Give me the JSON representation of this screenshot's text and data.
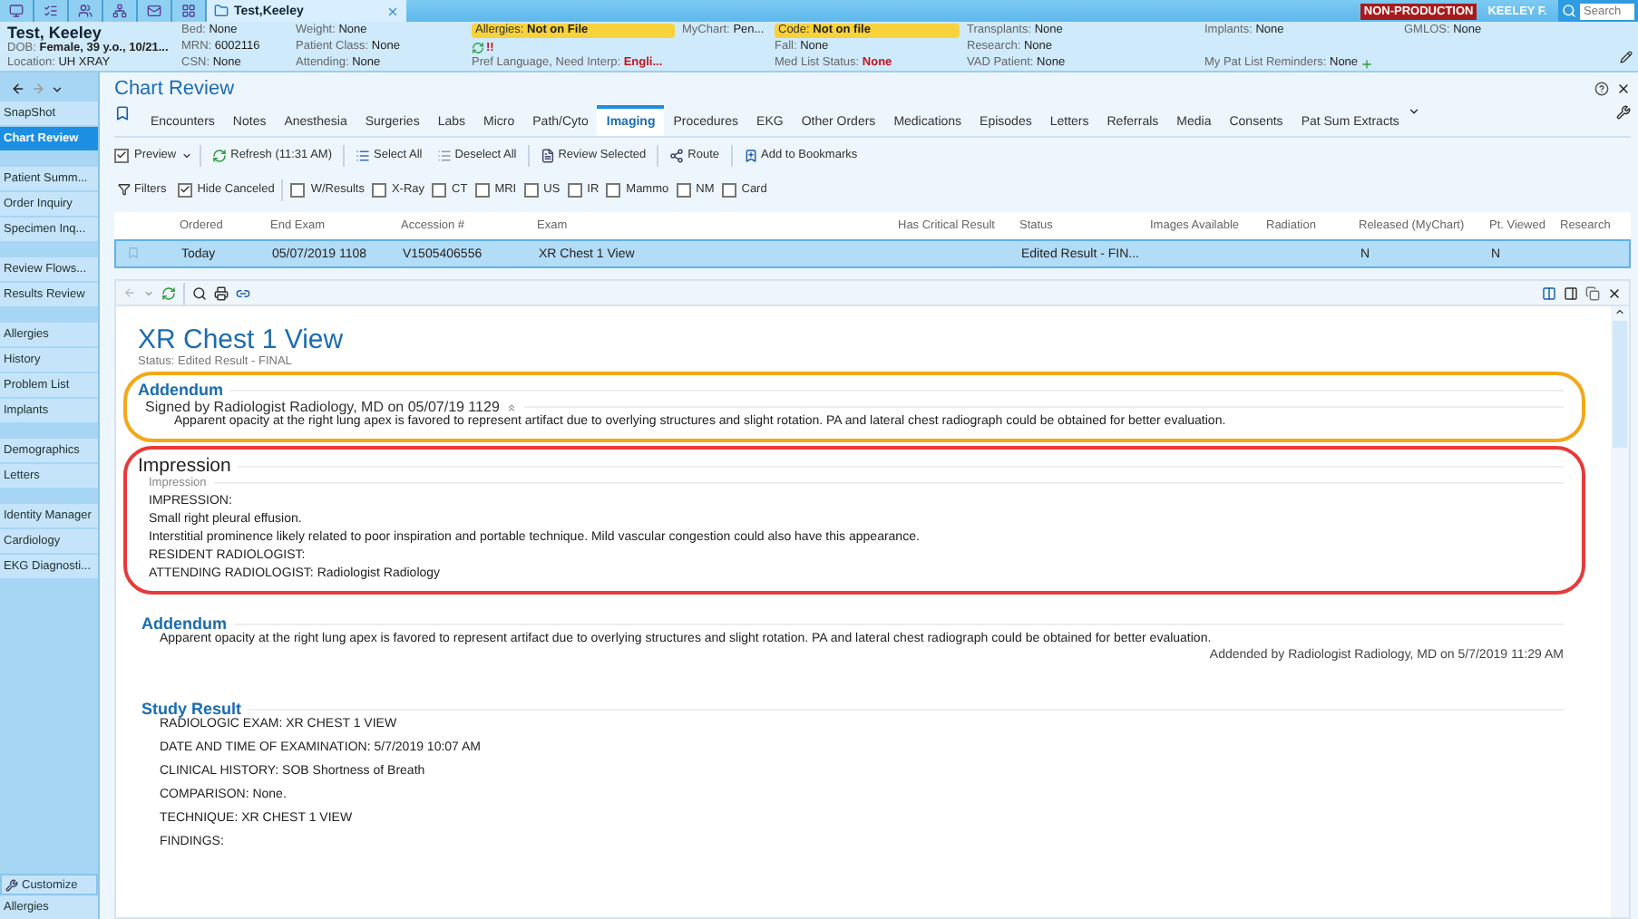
{
  "top_bar": {
    "tab_title": "Test,Keeley",
    "environment_badge": "NON-PRODUCTION",
    "user": "KEELEY F.",
    "search": {
      "placeholder": "Search"
    }
  },
  "patient_header": {
    "columns": [
      [
        {
          "kind": "name",
          "value": "Test, Keeley"
        },
        {
          "kind": "field",
          "label": "DOB:",
          "value": "Female, 39 y.o., 10/21...",
          "bold": true
        },
        {
          "kind": "field",
          "label": "Location:",
          "value": "UH XRAY"
        }
      ],
      [
        {
          "kind": "field",
          "label": "Bed:",
          "value": "None"
        },
        {
          "kind": "field",
          "label": "MRN:",
          "value": "6002116"
        },
        {
          "kind": "field",
          "label": "CSN:",
          "value": "None"
        }
      ],
      [
        {
          "kind": "field",
          "label": "Weight:",
          "value": "None"
        },
        {
          "kind": "field",
          "label": "Patient Class:",
          "value": "None"
        },
        {
          "kind": "field",
          "label": "Attending:",
          "value": "None"
        }
      ],
      [
        {
          "kind": "flag",
          "label": "Allergies:",
          "value": "Not on File"
        },
        {
          "kind": "status",
          "value": "!!"
        },
        {
          "kind": "field",
          "label": "Pref Language, Need Interp:",
          "value": "Engli...",
          "alert": true
        }
      ],
      [
        {
          "kind": "field",
          "label": "MyChart:",
          "value": "Pen..."
        }
      ],
      [
        {
          "kind": "flag",
          "label": "Code:",
          "value": "Not on file"
        },
        {
          "kind": "field",
          "label": "Fall:",
          "value": "None"
        },
        {
          "kind": "field",
          "label": "Med List Status:",
          "value": "None",
          "alert": true
        }
      ],
      [
        {
          "kind": "field",
          "label": "Transplants:",
          "value": "None"
        },
        {
          "kind": "field",
          "label": "Research:",
          "value": "None"
        },
        {
          "kind": "field",
          "label": "VAD Patient:",
          "value": "None"
        }
      ],
      [
        {
          "kind": "field",
          "label": "Implants:",
          "value": "None"
        },
        {
          "kind": "add",
          "label": "My Pat List Reminders:",
          "value": "None"
        }
      ],
      [
        {
          "kind": "field",
          "label": "GMLOS:",
          "value": "None"
        }
      ]
    ]
  },
  "sidebar": {
    "groups": [
      [
        {
          "label": "SnapShot",
          "selected": false
        },
        {
          "label": "Chart Review",
          "selected": true
        }
      ],
      [
        {
          "label": "Patient Summ...",
          "selected": false
        },
        {
          "label": "Order Inquiry",
          "selected": false
        },
        {
          "label": "Specimen Inq...",
          "selected": false
        }
      ],
      [
        {
          "label": "Review Flows...",
          "selected": false
        },
        {
          "label": "Results Review",
          "selected": false
        }
      ],
      [
        {
          "label": "Allergies",
          "selected": false
        },
        {
          "label": "History",
          "selected": false
        },
        {
          "label": "Problem List",
          "selected": false
        },
        {
          "label": "Implants",
          "selected": false
        }
      ],
      [
        {
          "label": "Demographics",
          "selected": false
        },
        {
          "label": "Letters",
          "selected": false
        }
      ],
      [
        {
          "label": "Identity Manager",
          "selected": false
        },
        {
          "label": "Cardiology",
          "selected": false
        },
        {
          "label": "EKG Diagnosti...",
          "selected": false
        }
      ]
    ],
    "customize_button": "Customize",
    "bottom_item": "Allergies"
  },
  "activity": {
    "title": "Chart Review",
    "tabs": [
      {
        "label": "Encounters",
        "selected": false
      },
      {
        "label": "Notes",
        "selected": false
      },
      {
        "label": "Anesthesia",
        "selected": false
      },
      {
        "label": "Surgeries",
        "selected": false
      },
      {
        "label": "Labs",
        "selected": false
      },
      {
        "label": "Micro",
        "selected": false
      },
      {
        "label": "Path/Cyto",
        "selected": false
      },
      {
        "label": "Imaging",
        "selected": true
      },
      {
        "label": "Procedures",
        "selected": false
      },
      {
        "label": "EKG",
        "selected": false
      },
      {
        "label": "Other Orders",
        "selected": false
      },
      {
        "label": "Medications",
        "selected": false
      },
      {
        "label": "Episodes",
        "selected": false
      },
      {
        "label": "Letters",
        "selected": false
      },
      {
        "label": "Referrals",
        "selected": false
      },
      {
        "label": "Media",
        "selected": false
      },
      {
        "label": "Consents",
        "selected": false
      },
      {
        "label": "Pat Sum Extracts",
        "selected": false
      }
    ],
    "toolbar": [
      {
        "kind": "preview",
        "label": "Preview",
        "checked": true
      },
      {
        "kind": "refresh",
        "label": "Refresh (11:31 AM)"
      },
      {
        "kind": "select",
        "label": "Select All"
      },
      {
        "kind": "deselect",
        "label": "Deselect All"
      },
      {
        "kind": "review",
        "label": "Review Selected"
      },
      {
        "kind": "route",
        "label": "Route"
      },
      {
        "kind": "bookmark",
        "label": "Add to Bookmarks"
      }
    ],
    "filters": {
      "label": "Filters",
      "options": [
        {
          "label": "Hide Canceled",
          "checked": true
        },
        {
          "label": "W/Results",
          "checked": false
        },
        {
          "label": "X-Ray",
          "checked": false
        },
        {
          "label": "CT",
          "checked": false
        },
        {
          "label": "MRI",
          "checked": false
        },
        {
          "label": "US",
          "checked": false
        },
        {
          "label": "IR",
          "checked": false
        },
        {
          "label": "Mammo",
          "checked": false
        },
        {
          "label": "NM",
          "checked": false
        },
        {
          "label": "Card",
          "checked": false
        }
      ]
    },
    "table": {
      "columns": [
        "Ordered",
        "End Exam",
        "Accession #",
        "Exam",
        "Has Critical Result",
        "Status",
        "Images Available",
        "Radiation",
        "Released (MyChart)",
        "Pt. Viewed",
        "Research"
      ],
      "rows": [
        {
          "selected": true,
          "cells": [
            "Today",
            "05/07/2019 1108",
            "V1505406556",
            "XR Chest 1 View",
            null,
            "Edited Result - FIN...",
            null,
            null,
            "N",
            "N",
            null
          ]
        }
      ]
    }
  },
  "report": {
    "title": "XR Chest 1 View",
    "status": "Status: Edited Result - FINAL",
    "sections": [
      {
        "kind": "signed",
        "heading": "Addendum",
        "color": "#f2a818",
        "signed_by": "Signed by Radiologist Radiology, MD on 05/07/19 1129",
        "lines": [
          "Apparent opacity at the right lung apex is favored to represent artifact due to overlying structures and slight rotation. PA and lateral chest radiograph could be obtained for better evaluation."
        ]
      },
      {
        "kind": "impression",
        "heading": "Impression",
        "color": "#e83a3a",
        "subheading": "Impression",
        "lines": [
          "IMPRESSION:",
          "Small right pleural effusion.",
          "Interstitial prominence likely related to poor inspiration and portable technique. Mild vascular congestion could also have this appearance.",
          "RESIDENT RADIOLOGIST:",
          "ATTENDING RADIOLOGIST: Radiologist Radiology"
        ]
      },
      {
        "kind": "addendum",
        "heading": "Addendum",
        "lines": [
          "Apparent opacity at the right lung apex is favored to represent artifact due to overlying structures and slight rotation. PA and lateral chest radiograph could be obtained for better evaluation."
        ],
        "footer": "Addended by Radiologist Radiology, MD on 5/7/2019 11:29 AM"
      },
      {
        "kind": "study",
        "heading": "Study Result",
        "lines": [
          "RADIOLOGIC EXAM: XR CHEST 1 VIEW",
          "DATE AND TIME OF EXAMINATION: 5/7/2019 10:07 AM",
          "CLINICAL HISTORY: SOB Shortness of Breath",
          "COMPARISON: None.",
          "TECHNIQUE: XR CHEST 1 VIEW",
          "FINDINGS:"
        ]
      }
    ]
  }
}
